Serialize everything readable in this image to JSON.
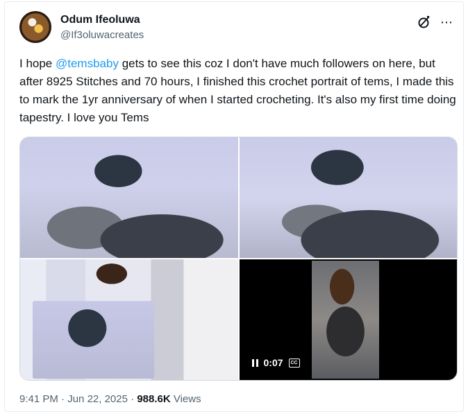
{
  "author": {
    "name": "Odum Ifeoluwa",
    "handle": "@If3oluwacreates",
    "avatar_icon": "profile-photo"
  },
  "header_icons": [
    "grok-icon",
    "more-icon"
  ],
  "tweet": {
    "text_prefix": "I hope ",
    "mention": "@temsbaby",
    "text_suffix": " gets to see this coz I don't have much followers on here, but after 8925 Stitches and 70 hours, I finished this crochet portrait of tems, I made this to mark the 1yr anniversary of when I started crocheting. It's also my first time doing tapestry. I love you Tems"
  },
  "media": {
    "video_duration": "0:07",
    "cc_label": "CC"
  },
  "meta": {
    "time": "9:41 PM",
    "separator": " · ",
    "date": "Jun 22, 2025",
    "views_count": "988.6K",
    "views_label": " Views"
  },
  "colors": {
    "accent": "#1d9bf0",
    "secondary_text": "#536471",
    "primary_text": "#0f1419"
  }
}
